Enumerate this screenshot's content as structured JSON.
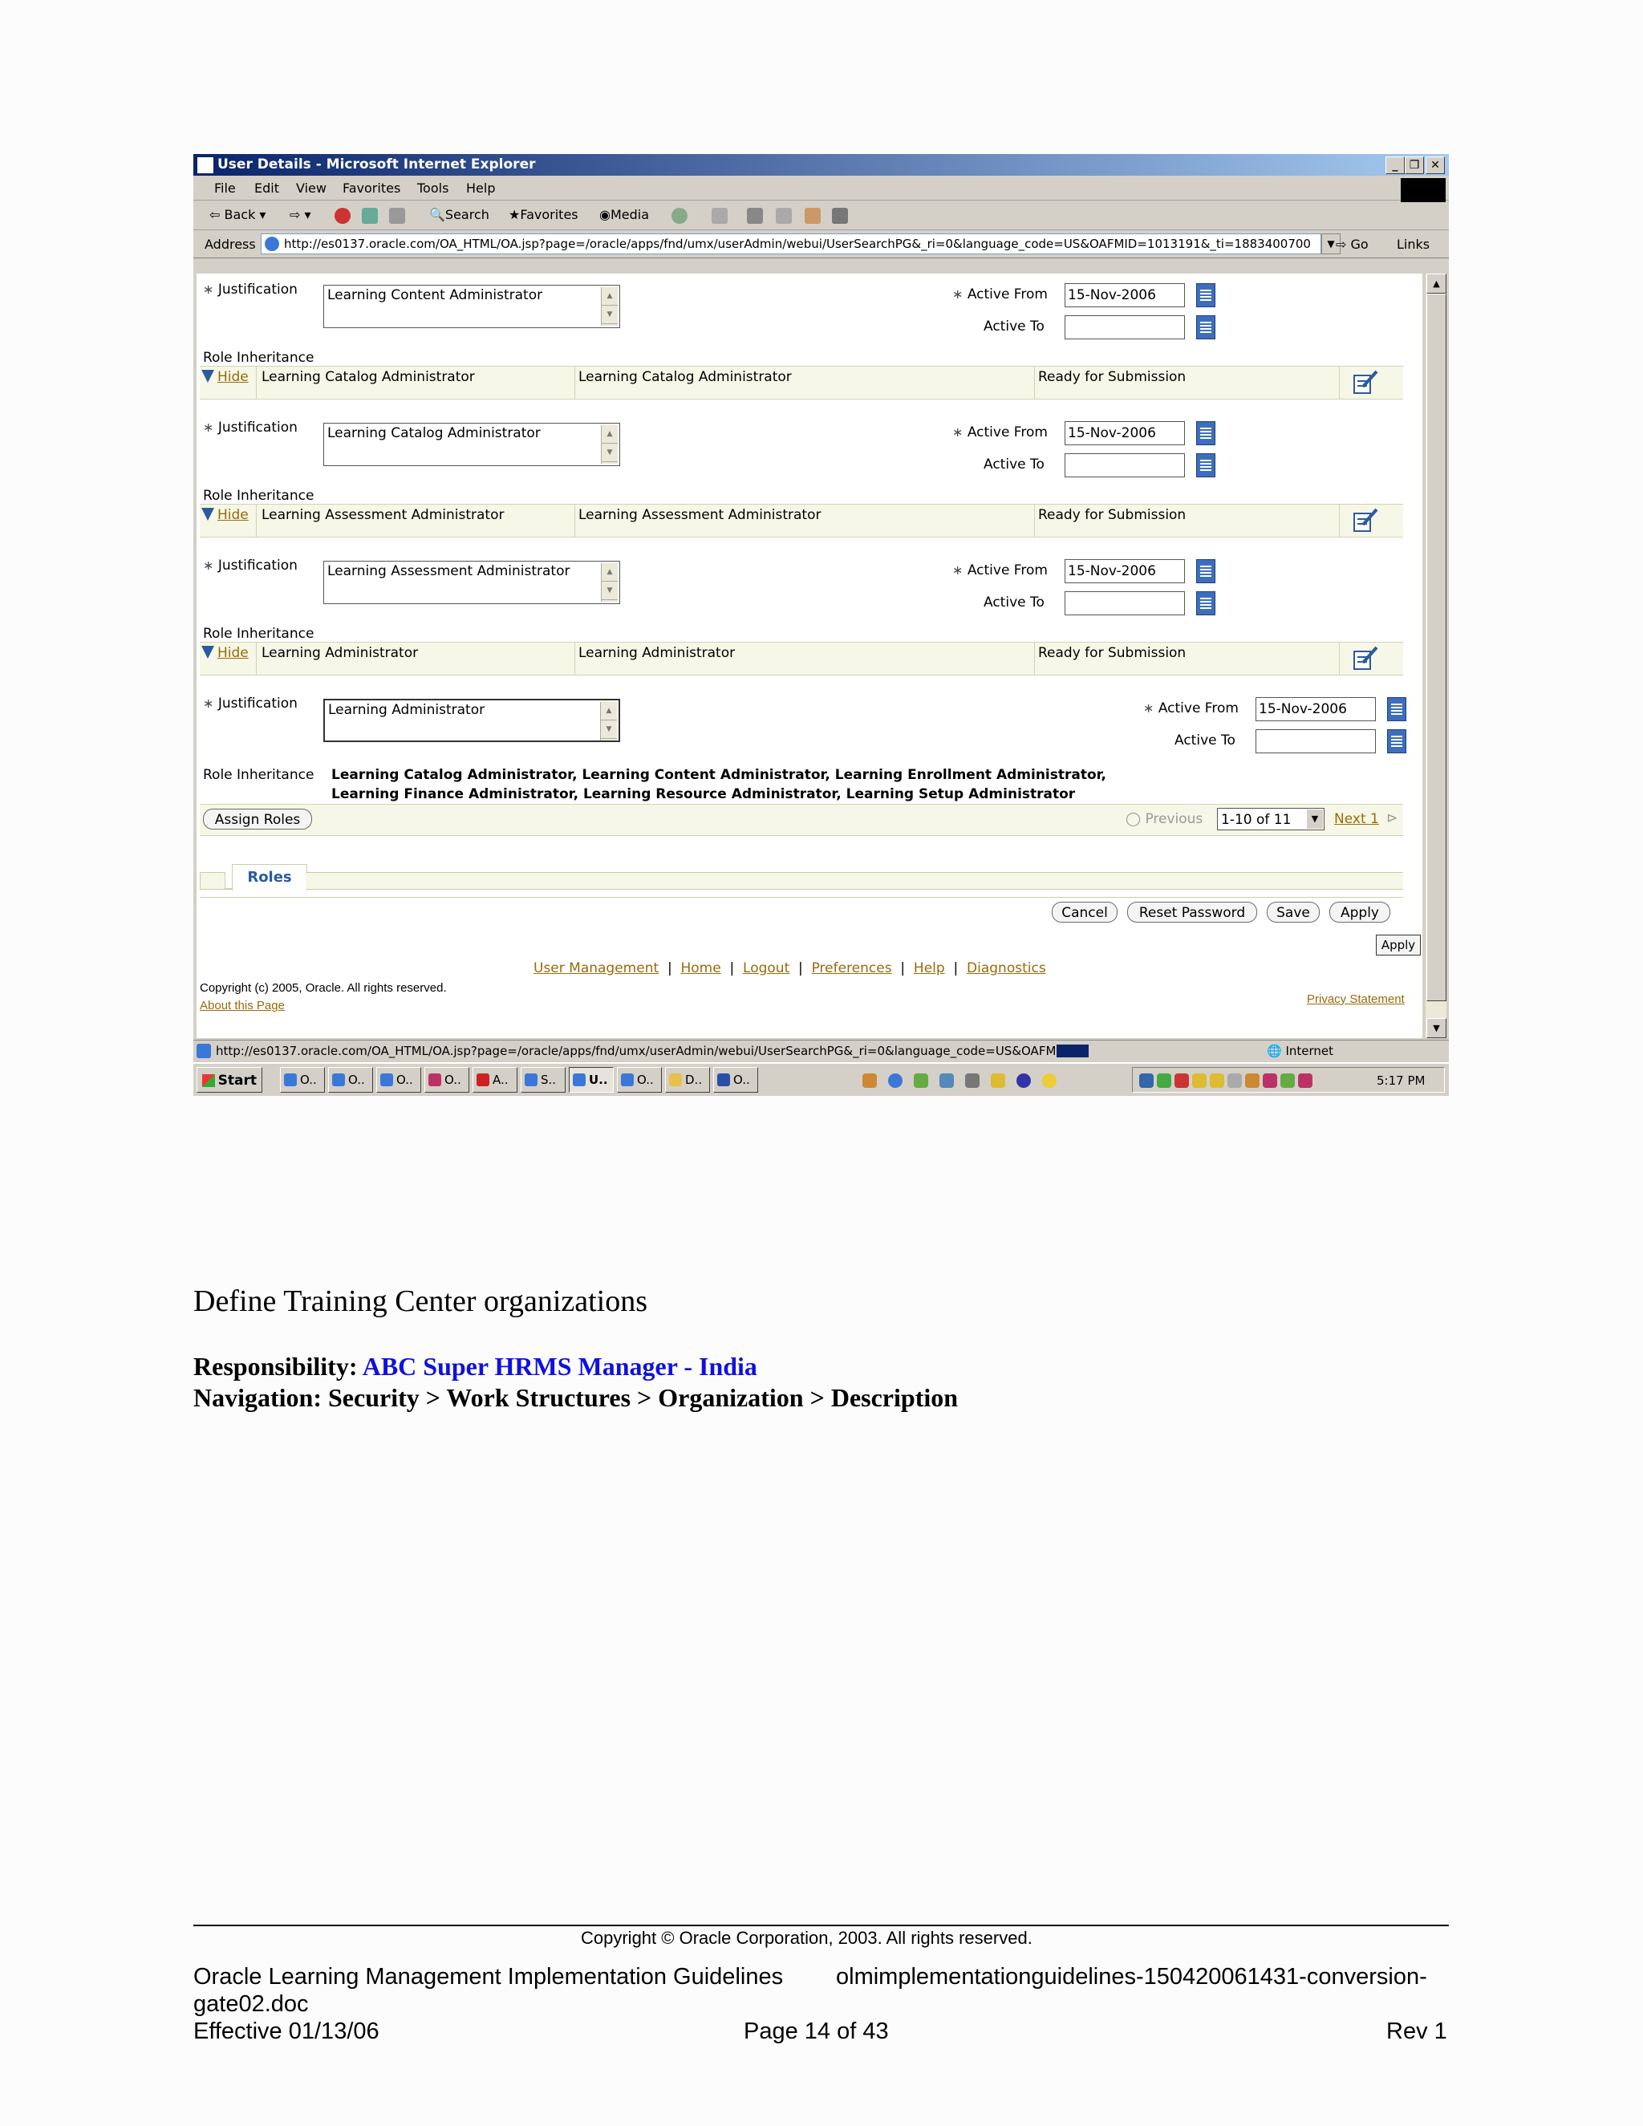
{
  "browser": {
    "title": "User Details - Microsoft Internet Explorer",
    "menu": [
      "File",
      "Edit",
      "View",
      "Favorites",
      "Tools",
      "Help"
    ],
    "toolbar": {
      "back": "Back",
      "search": "Search",
      "favorites": "Favorites",
      "media": "Media"
    },
    "address_label": "Address",
    "url": "http://es0137.oracle.com/OA_HTML/OA.jsp?page=/oracle/apps/fnd/umx/userAdmin/webui/UserSearchPG&_ri=0&language_code=US&OAFMID=1013191&_ti=1883400700",
    "go": "Go",
    "links": "Links",
    "status_url": "http://es0137.oracle.com/OA_HTML/OA.jsp?page=/oracle/apps/fnd/umx/userAdmin/webui/UserSearchPG&_ri=0&language_code=US&OAFM",
    "status_zone": "Internet"
  },
  "labels": {
    "justification": "Justification",
    "active_from": "Active From",
    "active_to": "Active To",
    "role_inheritance": "Role Inheritance",
    "hide": "Hide"
  },
  "roles": [
    {
      "justification": "Learning Content Administrator",
      "active_from": "15-Nov-2006",
      "active_to": ""
    },
    {
      "name": "Learning Catalog Administrator",
      "description": "Learning Catalog Administrator",
      "status": "Ready for Submission",
      "justification": "Learning Catalog Administrator",
      "active_from": "15-Nov-2006",
      "active_to": ""
    },
    {
      "name": "Learning Assessment Administrator",
      "description": "Learning Assessment Administrator",
      "status": "Ready for Submission",
      "justification": "Learning Assessment Administrator",
      "active_from": "15-Nov-2006",
      "active_to": ""
    },
    {
      "name": "Learning Administrator",
      "description": "Learning Administrator",
      "status": "Ready for Submission",
      "justification": "Learning Administrator",
      "active_from": "15-Nov-2006",
      "active_to": ""
    }
  ],
  "inheritance_line1": "Learning Catalog Administrator, Learning Content Administrator, Learning Enrollment Administrator,",
  "inheritance_line2": "Learning Finance Administrator, Learning Resource Administrator, Learning Setup Administrator",
  "pagination": {
    "assign_roles": "Assign Roles",
    "previous": "Previous",
    "range": "1-10 of 11",
    "next": "Next 1"
  },
  "tab": "Roles",
  "actions": {
    "cancel": "Cancel",
    "reset_password": "Reset Password",
    "save": "Save",
    "apply": "Apply",
    "apply_small": "Apply"
  },
  "footer_links": [
    "User Management",
    "Home",
    "Logout",
    "Preferences",
    "Help",
    "Diagnostics"
  ],
  "copyright_app": "Copyright (c) 2005, Oracle. All rights reserved.",
  "about_page": "About this Page",
  "privacy": "Privacy Statement",
  "taskbar": {
    "start": "Start",
    "tasks": [
      "O..",
      "O..",
      "O..",
      "O..",
      "A..",
      "S..",
      "U..",
      "O..",
      "D..",
      "O.."
    ],
    "clock": "5:17 PM"
  },
  "document": {
    "heading": "Define Training Center organizations",
    "responsibility_label": "Responsibility:",
    "responsibility_value": "ABC Super HRMS Manager - India",
    "navigation": "Navigation: Security > Work Structures > Organization > Description",
    "copyright": "Copyright © Oracle Corporation, 2003. All rights reserved.",
    "footer_line1_left": "Oracle Learning Management Implementation Guidelines",
    "footer_line1_right": "olmimplementationguidelines-150420061431-conversion-",
    "footer_line2": "gate02.doc",
    "effective": "Effective 01/13/06",
    "page": "Page 14 of  43",
    "rev": "Rev 1"
  },
  "colors": {
    "accent": "#0a246a",
    "link": "#9a6a0a",
    "responsibility": "#1010e0",
    "row_bar": "#f6f7e6"
  }
}
